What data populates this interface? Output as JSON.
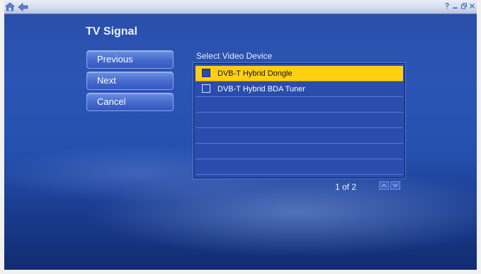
{
  "page": {
    "title": "TV Signal"
  },
  "topbar": {
    "nav_icons": [
      "home-icon",
      "back-icon"
    ],
    "window_controls": [
      "help-icon",
      "minimize-icon",
      "restore-icon",
      "close-icon"
    ]
  },
  "buttons": {
    "previous": "Previous",
    "next": "Next",
    "cancel": "Cancel"
  },
  "device_list": {
    "label": "Select Video Device",
    "items": [
      {
        "label": "DVB-T Hybrid Dongle",
        "selected": true
      },
      {
        "label": "DVB-T Hybrid BDA Tuner",
        "selected": false
      }
    ],
    "pager": "1 of 2",
    "scroll_icons": [
      "scroll-up-icon",
      "scroll-down-icon"
    ]
  },
  "colors": {
    "selection": "#ffcf14",
    "background": "#2b55b4",
    "button": "#4a6fd1"
  }
}
